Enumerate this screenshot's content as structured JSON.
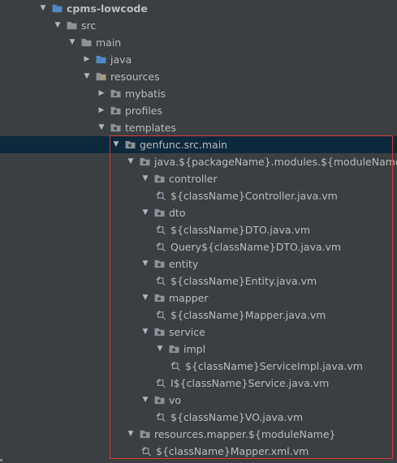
{
  "tree": {
    "rows": [
      {
        "label": "cpms-lowcode",
        "depth": 0,
        "type": "module",
        "arrow": "down"
      },
      {
        "label": "src",
        "depth": 1,
        "type": "folder",
        "arrow": "down"
      },
      {
        "label": "main",
        "depth": 2,
        "type": "folder",
        "arrow": "down"
      },
      {
        "label": "java",
        "depth": 3,
        "type": "src-folder",
        "arrow": "right"
      },
      {
        "label": "resources",
        "depth": 3,
        "type": "res-folder",
        "arrow": "down"
      },
      {
        "label": "mybatis",
        "depth": 4,
        "type": "package",
        "arrow": "right"
      },
      {
        "label": "profiles",
        "depth": 4,
        "type": "package",
        "arrow": "right"
      },
      {
        "label": "templates",
        "depth": 4,
        "type": "package",
        "arrow": "down"
      },
      {
        "label": "genfunc.src.main",
        "depth": 5,
        "type": "package",
        "arrow": "down",
        "selected": true
      },
      {
        "label": "java.${packageName}.modules.${moduleName}",
        "depth": 6,
        "type": "package",
        "arrow": "down"
      },
      {
        "label": "controller",
        "depth": 7,
        "type": "package",
        "arrow": "down"
      },
      {
        "label": "${className}Controller.java.vm",
        "depth": 8,
        "type": "vm",
        "arrow": ""
      },
      {
        "label": "dto",
        "depth": 7,
        "type": "package",
        "arrow": "down"
      },
      {
        "label": "${className}DTO.java.vm",
        "depth": 8,
        "type": "vm",
        "arrow": ""
      },
      {
        "label": "Query${className}DTO.java.vm",
        "depth": 8,
        "type": "vm",
        "arrow": ""
      },
      {
        "label": "entity",
        "depth": 7,
        "type": "package",
        "arrow": "down"
      },
      {
        "label": "${className}Entity.java.vm",
        "depth": 8,
        "type": "vm",
        "arrow": ""
      },
      {
        "label": "mapper",
        "depth": 7,
        "type": "package",
        "arrow": "down"
      },
      {
        "label": "${className}Mapper.java.vm",
        "depth": 8,
        "type": "vm",
        "arrow": ""
      },
      {
        "label": "service",
        "depth": 7,
        "type": "package",
        "arrow": "down"
      },
      {
        "label": "impl",
        "depth": 8,
        "type": "package",
        "arrow": "down"
      },
      {
        "label": "${className}ServiceImpl.java.vm",
        "depth": 9,
        "type": "vm",
        "arrow": ""
      },
      {
        "label": "I${className}Service.java.vm",
        "depth": 8,
        "type": "vm",
        "arrow": ""
      },
      {
        "label": "vo",
        "depth": 7,
        "type": "package",
        "arrow": "down"
      },
      {
        "label": "${className}VO.java.vm",
        "depth": 8,
        "type": "vm",
        "arrow": ""
      },
      {
        "label": "resources.mapper.${moduleName}",
        "depth": 6,
        "type": "package",
        "arrow": "down"
      },
      {
        "label": "${className}Mapper.xml.vm",
        "depth": 7,
        "type": "vm",
        "arrow": ""
      }
    ]
  },
  "colors": {
    "background": "#3c3f41",
    "selection": "#0d293e",
    "text": "#bbbbbb",
    "highlight_border": "#d63a3a",
    "folder_blue": "#4e8bc4",
    "folder_gray": "#8c9297"
  }
}
